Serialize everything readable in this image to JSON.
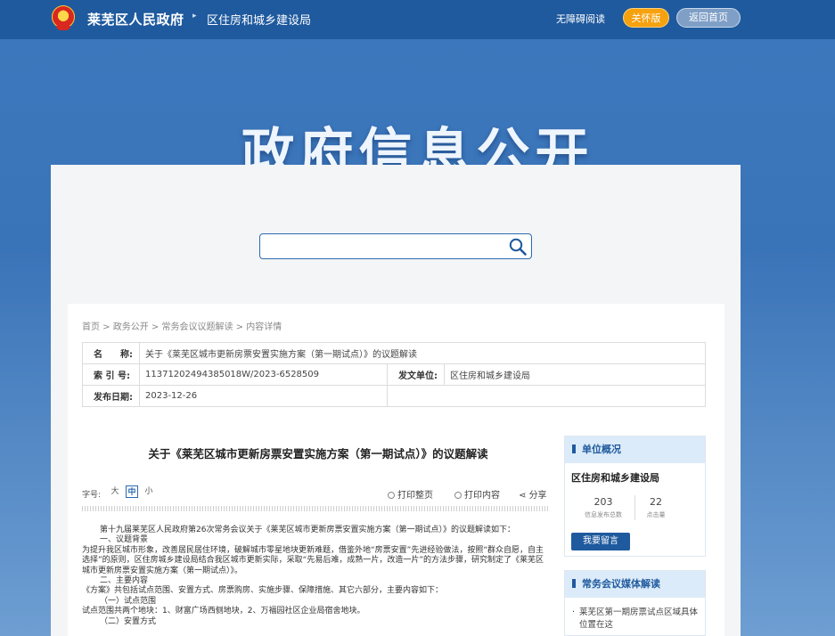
{
  "header": {
    "site_name": "莱芜区人民政府",
    "separator": "▸",
    "dept_name": "区住房和城乡建设局",
    "accessibility": "无障碍阅读",
    "care_mode": "关怀版",
    "home": "返回首页"
  },
  "banner": {
    "title": "政府信息公开"
  },
  "search": {
    "value": "",
    "placeholder": ""
  },
  "breadcrumb": {
    "items": [
      "首页",
      "政务公开",
      "常务会议议题解读",
      "内容详情"
    ],
    "sep": " > "
  },
  "info": {
    "name_label": "名　　称:",
    "name_value": "关于《莱芜区城市更新房票安置实施方案（第一期试点）》的议题解读",
    "index_label": "索 引 号:",
    "index_value": "11371202494385018W/2023-6528509",
    "issuer_label": "发文单位:",
    "issuer_value": "区住房和城乡建设局",
    "date_label": "发布日期:",
    "date_value": "2023-12-26"
  },
  "article": {
    "title": "关于《莱芜区城市更新房票安置实施方案（第一期试点）》的议题解读",
    "font_label": "字号:",
    "font_large": "大",
    "font_medium": "中",
    "font_small": "小",
    "print_page": "打印整页",
    "print_content": "打印内容",
    "share": "分享",
    "paragraphs": [
      "第十九届莱芜区人民政府第26次常务会议关于《莱芜区城市更新房票安置实施方案（第一期试点）》的议题解读如下：",
      "一、议题背景",
      "为提升我区城市形象，改善居民居住环境，破解城市零星地块更新难题，借鉴外地“房票安置”先进经验做法，按照“群众自愿，自主选择”的原则，区住房城乡建设局结合我区城市更新实际，采取“先易后难，成熟一片，改造一片”的方法步骤，研究制定了《莱芜区城市更新房票安置实施方案（第一期试点）》。",
      "二、主要内容",
      "《方案》共包括试点范围、安置方式、房票购房、实施步骤、保障措施、其它六部分，主要内容如下：",
      "（一）试点范围",
      "试点范围共两个地块：1、财富广场西侧地块，2、万福园社区企业局宿舍地块。",
      "（二）安置方式"
    ]
  },
  "sidebar": {
    "unit_title": "单位概况",
    "unit_name": "区住房和城乡建设局",
    "stat1_num": "203",
    "stat1_label": "信息发布总数",
    "stat2_num": "22",
    "stat2_label": "点击量",
    "message_btn": "我要留言",
    "media_title": "常务会议媒体解读",
    "media_items": [
      "莱芜区第一期房票试点区域具体位置在这"
    ]
  },
  "colors": {
    "brand": "#1f5a9e",
    "care": "#f6a10e",
    "panel": "#f4f5f7"
  }
}
